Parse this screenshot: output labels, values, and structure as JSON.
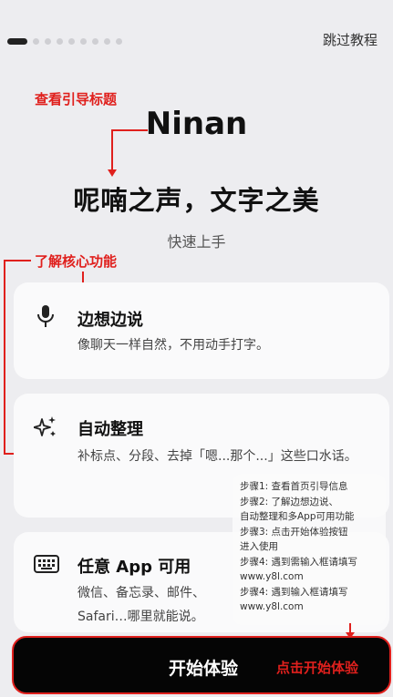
{
  "header": {
    "skip_label": "跳过教程",
    "page_count": 9,
    "active_page": 1
  },
  "intro": {
    "title": "Ninan",
    "subtitle": "呢喃之声，文字之美",
    "tagline": "快速上手"
  },
  "annotations": {
    "title_note": "查看引导标题",
    "feature_note": "了解核心功能",
    "button_note": "点击开始体验"
  },
  "features": [
    {
      "icon": "microphone-icon",
      "title": "边想边说",
      "desc": "像聊天一样自然，不用动手打字。"
    },
    {
      "icon": "sparkles-icon",
      "title": "自动整理",
      "desc": "补标点、分段、去掉「嗯...那个...」这些口水话。"
    },
    {
      "icon": "keyboard-icon",
      "title": "任意 App 可用",
      "desc": "微信、备忘录、邮件、Safari…哪里就能说。"
    }
  ],
  "steps_overlay": [
    "步骤1: 查看首页引导信息",
    "步骤2: 了解边想边说、",
    "自动整理和多App可用功能",
    "步骤3: 点击开始体验按钮",
    "进入使用",
    "步骤4: 遇到需输入框请填写",
    "www.y8l.com",
    "步骤4: 遇到输入框请填写",
    "www.y8l.com"
  ],
  "footer": {
    "start_label": "开始体验"
  },
  "colors": {
    "accent": "#e0201d",
    "button": "#050505",
    "background": "#ededf0"
  }
}
